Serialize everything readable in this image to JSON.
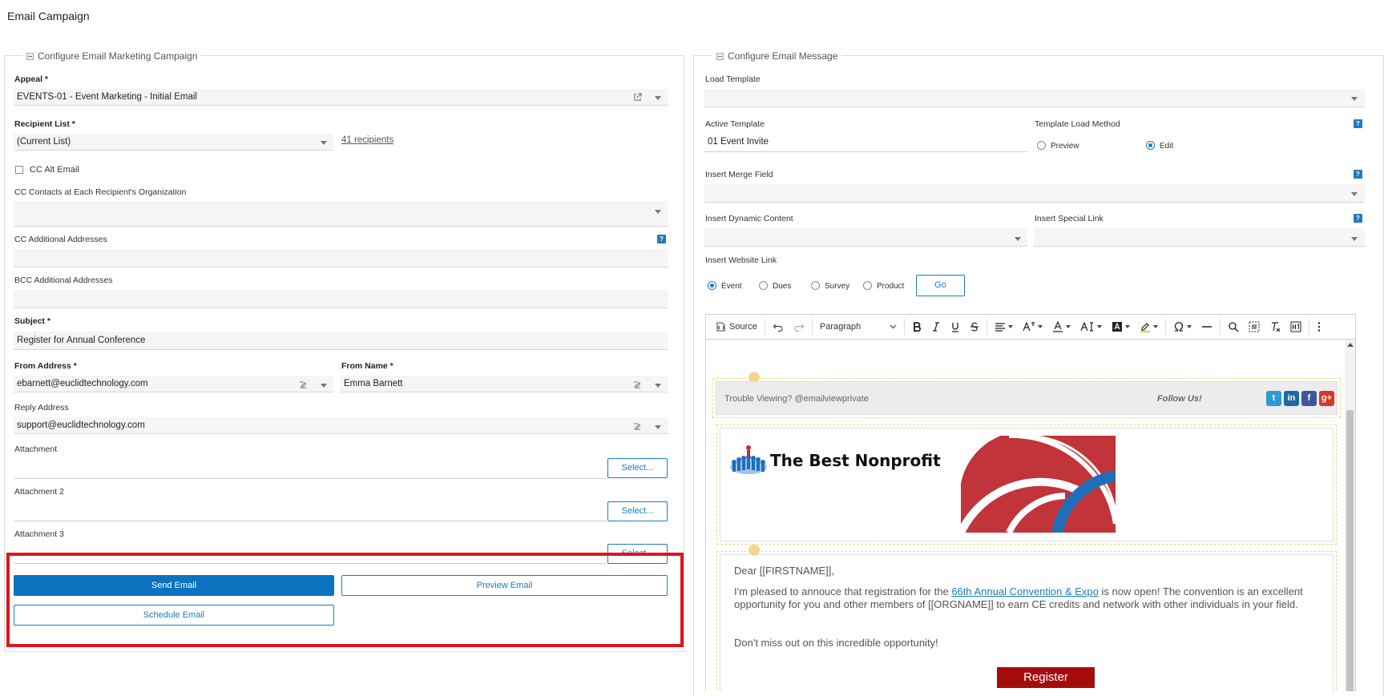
{
  "page": {
    "title": "Email Campaign"
  },
  "left_panel": {
    "legend": "Configure Email Marketing Campaign",
    "appeal": {
      "label": "Appeal *",
      "value": "EVENTS-01 - Event Marketing - Initial Email"
    },
    "recipient_list": {
      "label": "Recipient List *",
      "value": "(Current List)",
      "recipients_link": "41 recipients"
    },
    "cc_alt_email": {
      "label": "CC Alt Email",
      "checked": false
    },
    "cc_contacts": {
      "label": "CC Contacts at Each Recipient's Organization",
      "value": ""
    },
    "cc_additional": {
      "label": "CC Additional Addresses",
      "value": ""
    },
    "bcc_additional": {
      "label": "BCC Additional Addresses",
      "value": ""
    },
    "subject": {
      "label": "Subject *",
      "value": "Register for Annual Conference"
    },
    "from_address": {
      "label": "From Address *",
      "value": "ebarnett@euclidtechnology.com"
    },
    "from_name": {
      "label": "From Name *",
      "value": "Emma Barnett"
    },
    "reply_address": {
      "label": "Reply Address",
      "value": "support@euclidtechnology.com"
    },
    "attachments": [
      {
        "label": "Attachment",
        "button": "Select..."
      },
      {
        "label": "Attachment 2",
        "button": "Select..."
      },
      {
        "label": "Attachment 3",
        "button": "Select..."
      }
    ],
    "actions": {
      "send": "Send Email",
      "preview": "Preview Email",
      "schedule": "Schedule Email"
    }
  },
  "right_panel": {
    "legend": "Configure Email Message",
    "load_template": {
      "label": "Load Template",
      "value": ""
    },
    "active_template": {
      "label": "Active Template",
      "value": "01 Event Invite"
    },
    "template_load_method": {
      "label": "Template Load Method",
      "options": [
        "Preview",
        "Edit"
      ],
      "selected": "Edit"
    },
    "insert_merge_field": {
      "label": "Insert Merge Field",
      "value": ""
    },
    "insert_dynamic_content": {
      "label": "Insert Dynamic Content",
      "value": ""
    },
    "insert_special_link": {
      "label": "Insert Special Link",
      "value": ""
    },
    "insert_website_link": {
      "label": "Insert Website Link",
      "options": [
        "Event",
        "Dues",
        "Survey",
        "Product"
      ],
      "selected": "Event",
      "go_button": "Go"
    },
    "help_icon_text": "?"
  },
  "editor": {
    "toolbar": {
      "source": "Source",
      "paragraph": "Paragraph"
    },
    "email": {
      "trouble": "Trouble Viewing? @emailviewprivate",
      "follow": "Follow Us!",
      "brand": "The Best Nonprofit",
      "greeting": "Dear [[FIRSTNAME]],",
      "body_before_link": "I'm pleased to annouce that registration for the ",
      "body_link": "66th Annual Convention & Expo",
      "body_after_link": " is now open! The convention is an excellent opportunity for you and other members of [[ORGNAME]] to earn CE credits and network with other individuals in your field.",
      "closing": "Don't miss out on this incredible opportunity!",
      "register": "Register"
    }
  },
  "colors": {
    "primary": "#0b73c2",
    "highlight": "#d9161c",
    "register": "#a50d0d"
  }
}
